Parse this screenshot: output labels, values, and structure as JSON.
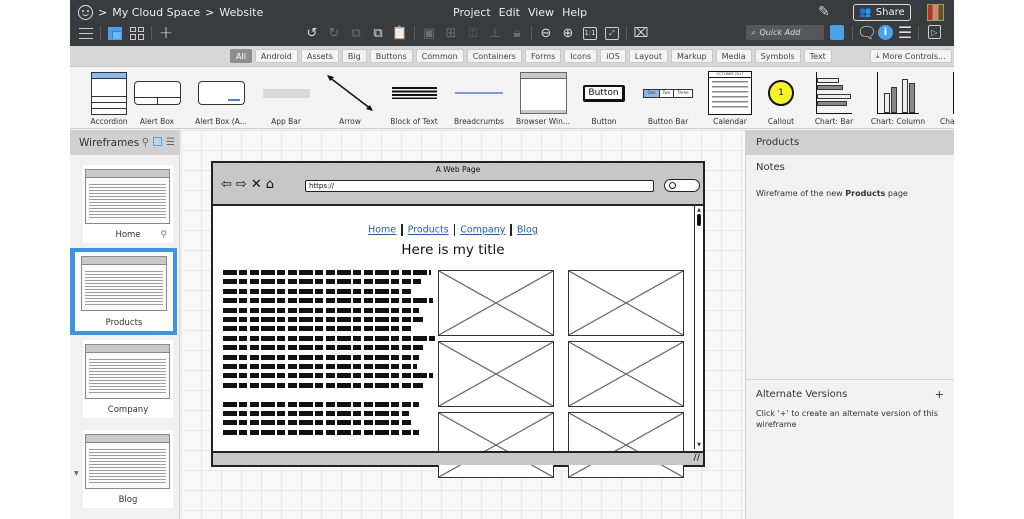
{
  "topbar": {
    "breadcrumb": [
      "My Cloud Space",
      "Website"
    ],
    "breadcrumb_sep": ">",
    "menu": [
      "Project",
      "Edit",
      "View",
      "Help"
    ],
    "share_label": "Share",
    "quick_add_placeholder": "Quick Add",
    "icons": {
      "app": "smiley-icon",
      "left": [
        "hamburger-icon",
        "single-view-icon",
        "grid-view-icon",
        "add-icon"
      ],
      "edit": [
        "undo-icon",
        "redo-icon",
        "duplicate-icon",
        "paste-special-icon",
        "clipboard-icon"
      ],
      "arrange": [
        "group-icon",
        "ungroup-icon",
        "bring-front-icon",
        "align-icon",
        "lock-icon"
      ],
      "zoom": [
        "zoom-out-icon",
        "zoom-in-icon",
        "actual-size-icon",
        "fullscreen-icon"
      ],
      "other": [
        "delete-icon",
        "pencil-icon",
        "share-people-icon",
        "avatar",
        "quick-add-search-icon",
        "ui-library-icon",
        "comment-icon",
        "info-icon",
        "notes-icon",
        "present-icon"
      ]
    },
    "actual_size_label": "1:1"
  },
  "categories": {
    "items": [
      "All",
      "Android",
      "Assets",
      "Big",
      "Buttons",
      "Common",
      "Containers",
      "Forms",
      "Icons",
      "iOS",
      "Layout",
      "Markup",
      "Media",
      "Symbols",
      "Text"
    ],
    "active": "All",
    "more_controls": "More Controls..."
  },
  "library": {
    "items": [
      "Accordion",
      "Alert Box",
      "Alert Box (A...",
      "App Bar",
      "Arrow",
      "Block of Text",
      "Breadcrumbs",
      "Browser Win...",
      "Button",
      "Button Bar",
      "Calendar",
      "Callout",
      "Chart: Bar",
      "Chart: Column",
      "Cha"
    ],
    "button_sample": "Button",
    "callout_number": "1",
    "buttonbar_labels": [
      "One",
      "Two",
      "Three"
    ],
    "calendar_header": "OCTOBER 2017"
  },
  "wireframes": {
    "title": "Wireframes",
    "items": [
      {
        "name": "Home",
        "selected": false
      },
      {
        "name": "Products",
        "selected": true
      },
      {
        "name": "Company",
        "selected": false
      },
      {
        "name": "Blog",
        "selected": false
      }
    ]
  },
  "mockup": {
    "window_title": "A Web Page",
    "url": "https://",
    "nav_links": [
      "Home",
      "Products",
      "Company",
      "Blog"
    ],
    "heading": "Here is my title"
  },
  "properties": {
    "title": "Products",
    "notes_title": "Notes",
    "notes_prefix": "Wireframe of the new ",
    "notes_bold": "Products",
    "notes_suffix": " page",
    "alt_title": "Alternate Versions",
    "alt_add": "+",
    "alt_text": "Click '+' to create an alternate version of this wireframe"
  },
  "colors": {
    "accent": "#3d95e0",
    "topbar_bg": "#393b3f",
    "link": "#1f5fa8"
  }
}
